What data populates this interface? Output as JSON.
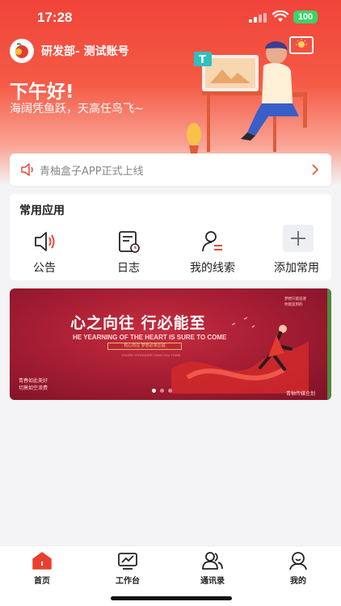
{
  "status_bar": {
    "time": "17:28",
    "battery": "100"
  },
  "header": {
    "org_name": "研发部- 测试账号",
    "greeting": "下午好!",
    "slogan": "海阔凭鱼跃，天高任鸟飞~"
  },
  "notice": {
    "text": "青柚盒子APP正式上线"
  },
  "apps": {
    "title": "常用应用",
    "items": [
      {
        "label": "公告",
        "icon": "speaker-icon"
      },
      {
        "label": "日志",
        "icon": "log-icon"
      },
      {
        "label": "我的线索",
        "icon": "user-lead-icon"
      },
      {
        "label": "添加常用",
        "icon": "plus-icon"
      }
    ]
  },
  "banner": {
    "headline": "心之向往 行必能至",
    "subheadline": "HE YEARNING OF THE HEART IS SURE TO COME",
    "badge": "有心向往 梦想必将达成",
    "tagline": "YOU'RE STRONGER THAN YOU THINK",
    "left_line1": "青春如此美好",
    "left_line2": "切莫如空浪费",
    "right_text": "青柚传媒企划",
    "top_right_line1": "梦想只能追逐",
    "top_right_line2": "你能追到的",
    "slide_count": 3,
    "active_slide": 1
  },
  "tabbar": {
    "items": [
      {
        "label": "首页",
        "icon": "home-icon",
        "active": true
      },
      {
        "label": "工作台",
        "icon": "workbench-icon",
        "active": false
      },
      {
        "label": "通讯录",
        "icon": "contacts-icon",
        "active": false
      },
      {
        "label": "我的",
        "icon": "profile-icon",
        "active": false
      }
    ]
  },
  "colors": {
    "accent": "#f0443a",
    "banner": "#a81e34",
    "battery": "#3dd36a"
  }
}
